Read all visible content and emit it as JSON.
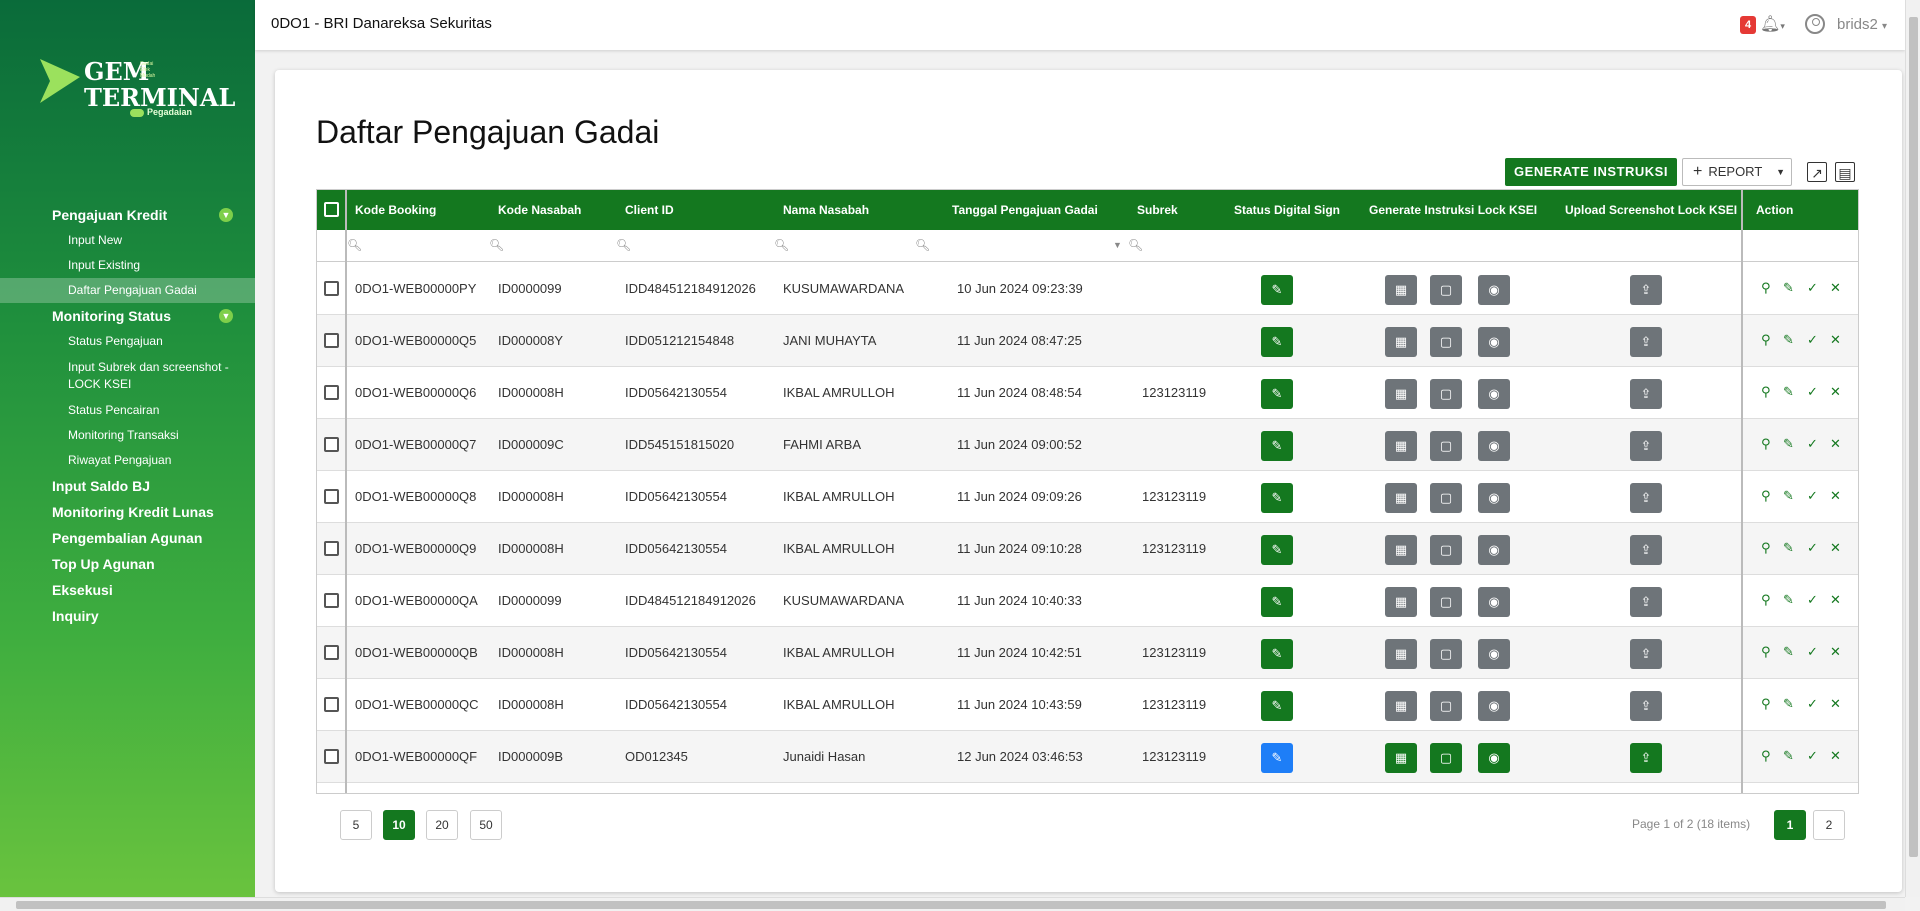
{
  "app": {
    "title": "0DO1 - BRI Danareksa Sekuritas",
    "notification_count": "4",
    "username": "brids2"
  },
  "logo": {
    "line1": "GEM",
    "line2": "TERMINAL",
    "small": "Gadai\nEfek\nMudah",
    "brand": "Pegadaian"
  },
  "sidebar": {
    "groups": [
      {
        "label": "Pengajuan Kredit",
        "items": [
          "Input New",
          "Input Existing",
          "Daftar Pengajuan Gadai"
        ]
      },
      {
        "label": "Monitoring Status",
        "items": [
          "Status Pengajuan",
          "Input Subrek dan screenshot - LOCK KSEI",
          "Status Pencairan",
          "Monitoring Transaksi",
          "Riwayat Pengajuan"
        ]
      }
    ],
    "links": [
      "Input Saldo BJ",
      "Monitoring Kredit Lunas",
      "Pengembalian Agunan",
      "Top Up Agunan",
      "Eksekusi",
      "Inquiry"
    ]
  },
  "page": {
    "title": "Daftar Pengajuan Gadai",
    "generate_label": "GENERATE INSTRUKSI",
    "report_label": "REPORT"
  },
  "table": {
    "columns": [
      "Kode Booking",
      "Kode Nasabah",
      "Client ID",
      "Nama Nasabah",
      "Tanggal Pengajuan Gadai",
      "Subrek",
      "Status Digital Sign",
      "Generate Instruksi Lock KSEI",
      "Upload Screenshot Lock KSEI",
      "Action"
    ],
    "rows": [
      {
        "kode_booking": "0DO1-WEB00000PY",
        "kode_nasabah": "ID0000099",
        "client_id": "IDD484512184912026",
        "nama": "KUSUMAWARDANA",
        "tanggal": "10 Jun 2024 09:23:39",
        "subrek": "",
        "state": "pending"
      },
      {
        "kode_booking": "0DO1-WEB00000Q5",
        "kode_nasabah": "ID000008Y",
        "client_id": "IDD051212154848",
        "nama": "JANI MUHAYTA",
        "tanggal": "11 Jun 2024 08:47:25",
        "subrek": "",
        "state": "pending"
      },
      {
        "kode_booking": "0DO1-WEB00000Q6",
        "kode_nasabah": "ID000008H",
        "client_id": "IDD05642130554",
        "nama": "IKBAL AMRULLOH",
        "tanggal": "11 Jun 2024 08:48:54",
        "subrek": "123123119",
        "state": "pending"
      },
      {
        "kode_booking": "0DO1-WEB00000Q7",
        "kode_nasabah": "ID000009C",
        "client_id": "IDD545151815020",
        "nama": "FAHMI ARBA",
        "tanggal": "11 Jun 2024 09:00:52",
        "subrek": "",
        "state": "pending"
      },
      {
        "kode_booking": "0DO1-WEB00000Q8",
        "kode_nasabah": "ID000008H",
        "client_id": "IDD05642130554",
        "nama": "IKBAL AMRULLOH",
        "tanggal": "11 Jun 2024 09:09:26",
        "subrek": "123123119",
        "state": "pending"
      },
      {
        "kode_booking": "0DO1-WEB00000Q9",
        "kode_nasabah": "ID000008H",
        "client_id": "IDD05642130554",
        "nama": "IKBAL AMRULLOH",
        "tanggal": "11 Jun 2024 09:10:28",
        "subrek": "123123119",
        "state": "pending"
      },
      {
        "kode_booking": "0DO1-WEB00000QA",
        "kode_nasabah": "ID0000099",
        "client_id": "IDD484512184912026",
        "nama": "KUSUMAWARDANA",
        "tanggal": "11 Jun 2024 10:40:33",
        "subrek": "",
        "state": "pending"
      },
      {
        "kode_booking": "0DO1-WEB00000QB",
        "kode_nasabah": "ID000008H",
        "client_id": "IDD05642130554",
        "nama": "IKBAL AMRULLOH",
        "tanggal": "11 Jun 2024 10:42:51",
        "subrek": "123123119",
        "state": "pending"
      },
      {
        "kode_booking": "0DO1-WEB00000QC",
        "kode_nasabah": "ID000008H",
        "client_id": "IDD05642130554",
        "nama": "IKBAL AMRULLOH",
        "tanggal": "11 Jun 2024 10:43:59",
        "subrek": "123123119",
        "state": "pending"
      },
      {
        "kode_booking": "0DO1-WEB00000QF",
        "kode_nasabah": "ID000009B",
        "client_id": "OD012345",
        "nama": "Junaidi Hasan",
        "tanggal": "12 Jun 2024 03:46:53",
        "subrek": "123123119",
        "state": "active"
      }
    ]
  },
  "pager": {
    "sizes": [
      "5",
      "10",
      "20",
      "50"
    ],
    "selected_size": "10",
    "info": "Page 1 of 2 (18 items)",
    "pages": [
      "1",
      "2"
    ],
    "current_page": "1"
  },
  "colors": {
    "primary": "#14781f",
    "grey_button": "#6e7479",
    "blue_button": "#1e7ef7",
    "badge": "#e53935"
  }
}
